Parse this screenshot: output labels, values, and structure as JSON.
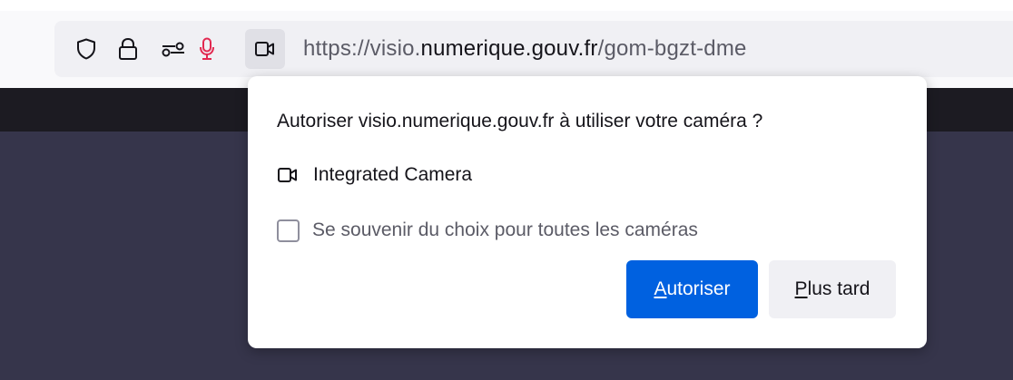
{
  "urlbar": {
    "url_prefix": "https://visio.",
    "url_host": "numerique.gouv.fr",
    "url_path": "/gom-bgzt-dme",
    "icons": [
      "shield-icon",
      "lock-icon",
      "permissions-icon",
      "microphone-icon",
      "camera-icon"
    ]
  },
  "permission_panel": {
    "title": "Autoriser visio.numerique.gouv.fr à utiliser votre caméra ?",
    "device_label": "Integrated Camera",
    "remember_label": "Se souvenir du choix pour toutes les caméras",
    "remember_checked": false,
    "allow_button": {
      "accesskey": "A",
      "label_rest": "utoriser"
    },
    "later_button": {
      "accesskey": "P",
      "label_rest": "lus tard"
    }
  },
  "colors": {
    "primary_button": "#0061e0",
    "microphone_active": "#e22850",
    "page_background": "#36354b",
    "page_band": "#1c1b22"
  }
}
